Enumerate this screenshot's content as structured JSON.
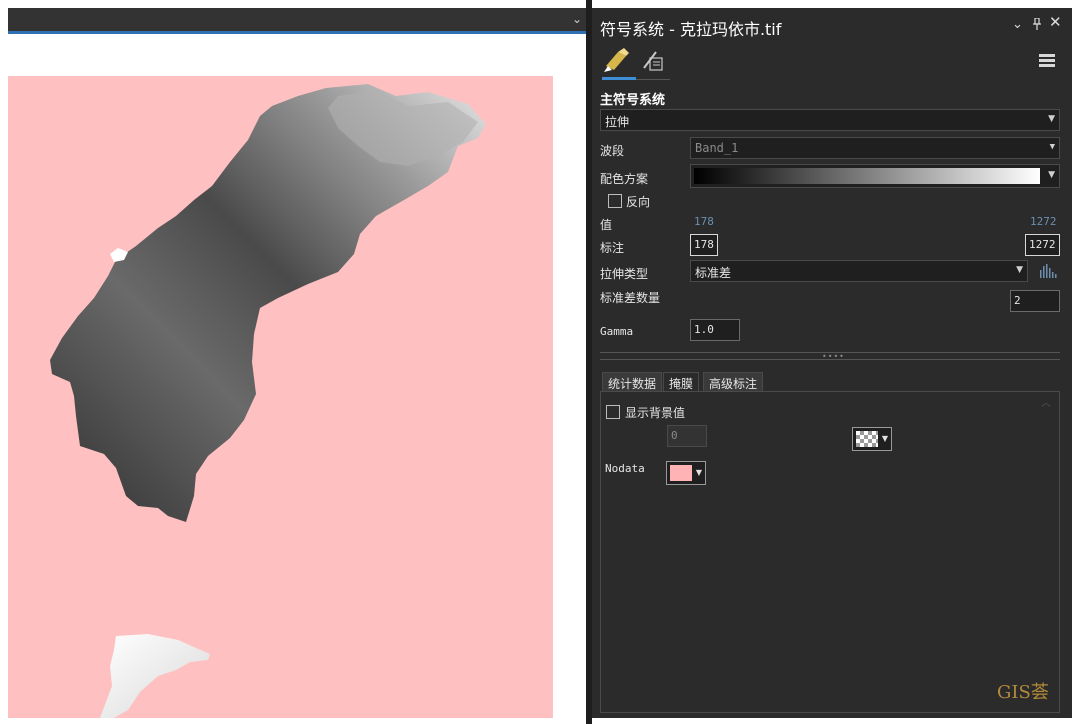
{
  "colors": {
    "map_background": "#ffc0c1",
    "pane_background": "#2b2b2b",
    "accent_blue": "#3f8fd8",
    "nodata_color": "#ffb3b5"
  },
  "pane": {
    "title": "符号系统 - 克拉玛依市.tif",
    "icons": [
      "chevron-down-icon",
      "pin-icon",
      "close-icon",
      "menu-icon"
    ]
  },
  "primary": {
    "section_title": "主符号系统",
    "renderer_type": "拉伸",
    "band_label": "波段",
    "band_value": "Band_1",
    "color_scheme_label": "配色方案",
    "color_scheme_ramp": "black-to-white",
    "invert_label": "反向",
    "invert_checked": false,
    "value_label": "值",
    "value_min": "178",
    "value_max": "1272",
    "label_label": "标注",
    "label_min": "178",
    "label_max": "1272",
    "stretch_type_label": "拉伸类型",
    "stretch_type_value": "标准差",
    "num_stddev_label": "标准差数量",
    "num_stddev_value": "2",
    "gamma_label": "Gamma",
    "gamma_value": "1.0"
  },
  "tabs": [
    {
      "label": "统计数据",
      "active": false
    },
    {
      "label": "掩膜",
      "active": true
    },
    {
      "label": "高级标注",
      "active": false
    }
  ],
  "mask": {
    "show_background_label": "显示背景值",
    "show_background_checked": false,
    "background_value": "0",
    "nodata_label": "Nodata"
  },
  "watermark": "GIS荟"
}
